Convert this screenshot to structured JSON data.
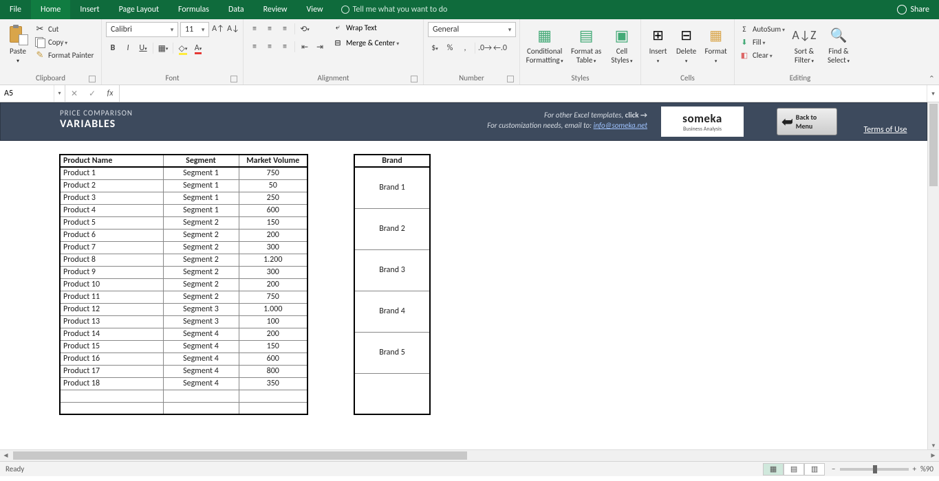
{
  "tabs": [
    "File",
    "Home",
    "Insert",
    "Page Layout",
    "Formulas",
    "Data",
    "Review",
    "View"
  ],
  "selected_tab": "Home",
  "tell_me": "Tell me what you want to do",
  "share": "Share",
  "ribbon": {
    "clipboard": {
      "label": "Clipboard",
      "paste": "Paste",
      "cut": "Cut",
      "copy": "Copy",
      "format_painter": "Format Painter"
    },
    "font": {
      "label": "Font",
      "name": "Calibri",
      "size": "11",
      "bold": "B",
      "italic": "I",
      "underline": "U"
    },
    "alignment": {
      "label": "Alignment",
      "wrap": "Wrap Text",
      "merge": "Merge & Center"
    },
    "number": {
      "label": "Number",
      "format": "General"
    },
    "styles": {
      "label": "Styles",
      "cond": "Conditional Formatting",
      "table": "Format as Table",
      "cell": "Cell Styles"
    },
    "cells": {
      "label": "Cells",
      "insert": "Insert",
      "delete": "Delete",
      "format": "Format"
    },
    "editing": {
      "label": "Editing",
      "autosum": "AutoSum",
      "fill": "Fill",
      "clear": "Clear",
      "sort": "Sort & Filter",
      "find": "Find & Select"
    }
  },
  "namebox": "A5",
  "banner": {
    "line1": "PRICE COMPARISON",
    "line2": "VARIABLES",
    "other": "For other Excel templates,",
    "click": "click →",
    "custom": "For customization needs, email to:",
    "email": "info@someka.net",
    "logo1": "someka",
    "logo2": "Business Analysis",
    "back1": "Back to",
    "back2": "Menu",
    "tou": "Terms of Use"
  },
  "products": {
    "headers": [
      "Product Name",
      "Segment",
      "Market Volume"
    ],
    "rows": [
      [
        "Product 1",
        "Segment 1",
        "750"
      ],
      [
        "Product 2",
        "Segment 1",
        "50"
      ],
      [
        "Product 3",
        "Segment 1",
        "250"
      ],
      [
        "Product 4",
        "Segment 1",
        "600"
      ],
      [
        "Product 5",
        "Segment 2",
        "150"
      ],
      [
        "Product 6",
        "Segment 2",
        "200"
      ],
      [
        "Product 7",
        "Segment 2",
        "300"
      ],
      [
        "Product 8",
        "Segment 2",
        "1.200"
      ],
      [
        "Product 9",
        "Segment 2",
        "300"
      ],
      [
        "Product 10",
        "Segment 2",
        "200"
      ],
      [
        "Product 11",
        "Segment 2",
        "750"
      ],
      [
        "Product 12",
        "Segment 3",
        "1.000"
      ],
      [
        "Product 13",
        "Segment 3",
        "100"
      ],
      [
        "Product 14",
        "Segment 4",
        "200"
      ],
      [
        "Product 15",
        "Segment 4",
        "150"
      ],
      [
        "Product 16",
        "Segment 4",
        "600"
      ],
      [
        "Product 17",
        "Segment 4",
        "800"
      ],
      [
        "Product 18",
        "Segment 4",
        "350"
      ],
      [
        "",
        "",
        ""
      ],
      [
        "",
        "",
        ""
      ]
    ]
  },
  "brands": {
    "header": "Brand",
    "rows": [
      "Brand 1",
      "Brand 2",
      "Brand 3",
      "Brand 4",
      "Brand 5",
      ""
    ]
  },
  "status": {
    "ready": "Ready",
    "zoom": "%90"
  }
}
